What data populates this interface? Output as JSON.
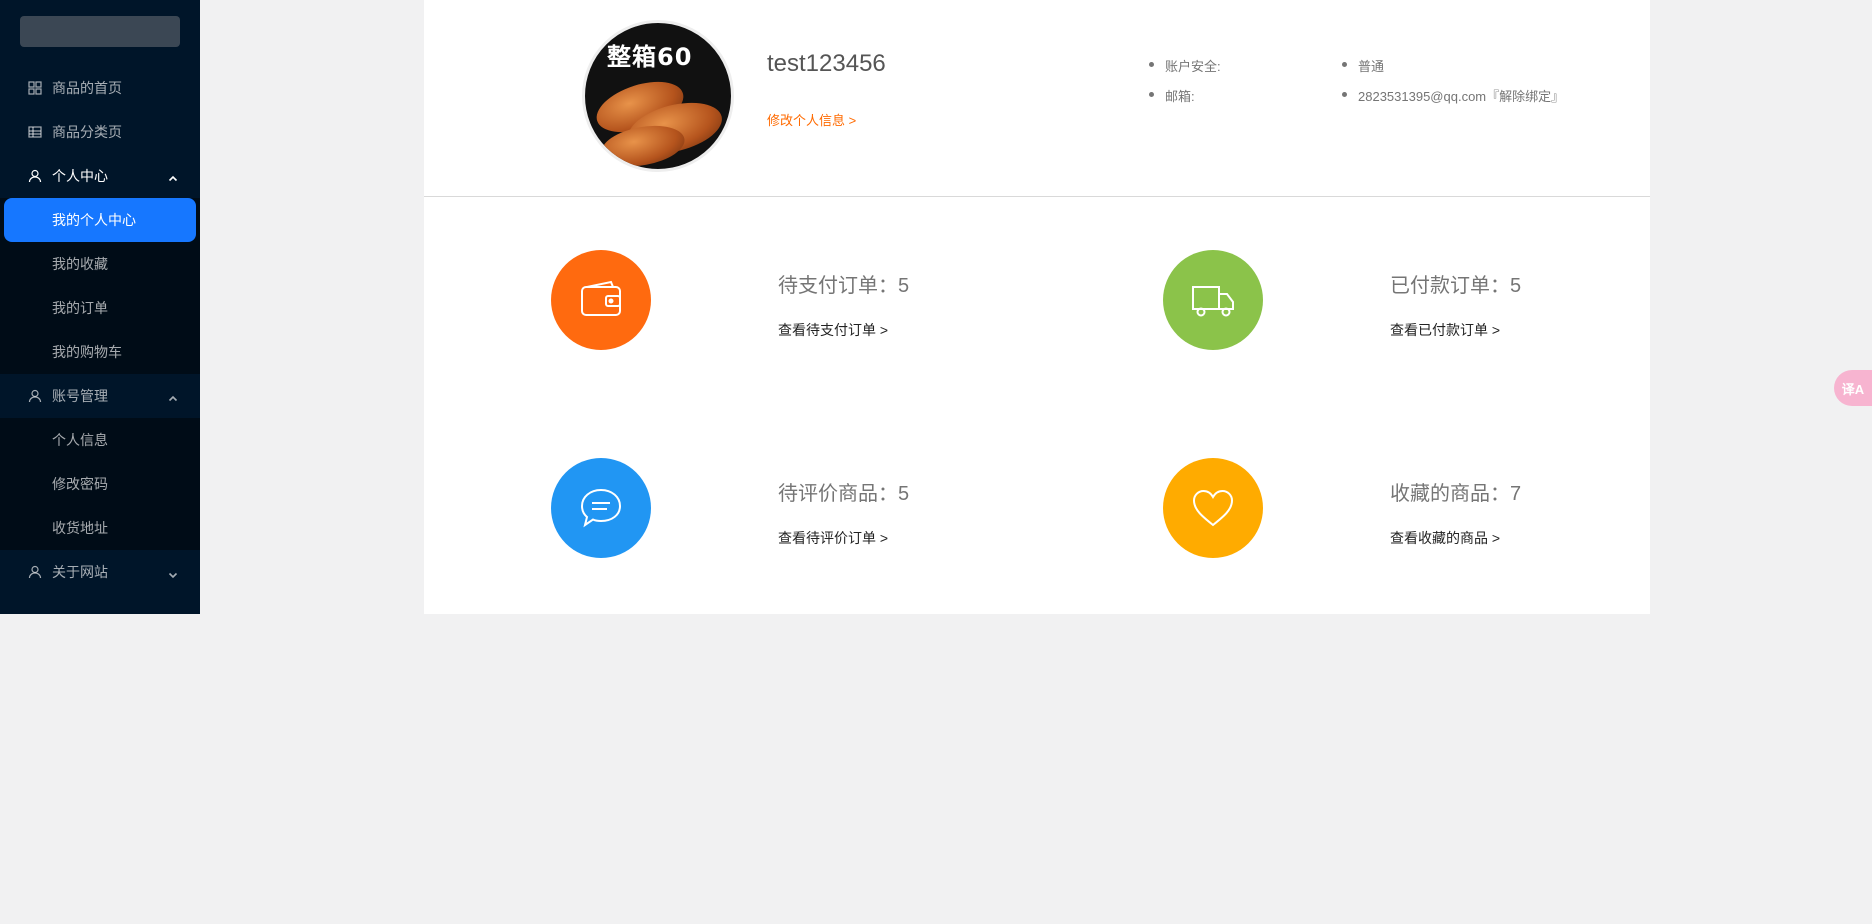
{
  "sidebar": {
    "menu": [
      {
        "label": "商品的首页",
        "icon": "dashboard-icon"
      },
      {
        "label": "商品分类页",
        "icon": "table-icon"
      },
      {
        "label": "个人中心",
        "icon": "user-icon",
        "open": true,
        "children": [
          "我的个人中心",
          "我的收藏",
          "我的订单",
          "我的购物车"
        ],
        "active_child": "我的个人中心"
      },
      {
        "label": "账号管理",
        "icon": "user-icon",
        "open": true,
        "children": [
          "个人信息",
          "修改密码",
          "收货地址"
        ]
      },
      {
        "label": "关于网站",
        "icon": "user-icon",
        "open": false
      }
    ]
  },
  "profile": {
    "avatar_banner": "整箱60",
    "username": "test123456",
    "edit_link": "修改个人信息 >",
    "info_labels": [
      "账户安全:",
      "邮箱:"
    ],
    "info_values": [
      "普通",
      "2823531395@qq.com『解除绑定』"
    ]
  },
  "stats": [
    {
      "title": "待支付订单：5",
      "link": "查看待支付订单 >",
      "color": "#ff6a0f",
      "icon": "wallet-icon"
    },
    {
      "title": "已付款订单：5",
      "link": "查看已付款订单 >",
      "color": "#8bc34a",
      "icon": "truck-icon"
    },
    {
      "title": "待评价商品：5",
      "link": "查看待评价订单 >",
      "color": "#2196f3",
      "icon": "chat-bubble-icon"
    },
    {
      "title": "收藏的商品：7",
      "link": "查看收藏的商品 >",
      "color": "#ffab00",
      "icon": "heart-icon"
    }
  ],
  "colors": {
    "sidebar_bg": "#001529",
    "active_item": "#1677ff",
    "accent_orange": "#ff6a00"
  },
  "translate_button": {
    "label": "译A",
    "icon": "translate-icon"
  }
}
